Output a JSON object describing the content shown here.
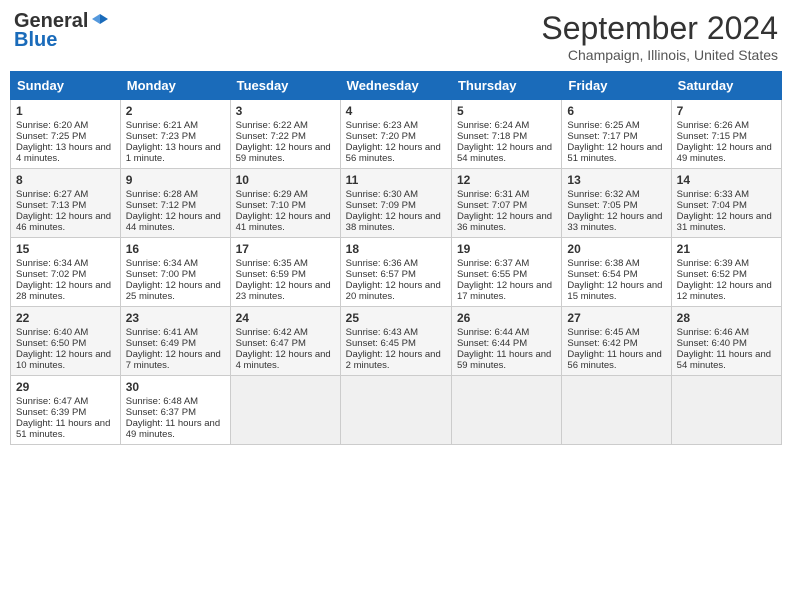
{
  "header": {
    "logo_line1": "General",
    "logo_line2": "Blue",
    "month_title": "September 2024",
    "location": "Champaign, Illinois, United States"
  },
  "days_of_week": [
    "Sunday",
    "Monday",
    "Tuesday",
    "Wednesday",
    "Thursday",
    "Friday",
    "Saturday"
  ],
  "weeks": [
    [
      {
        "day": "1",
        "sunrise": "Sunrise: 6:20 AM",
        "sunset": "Sunset: 7:25 PM",
        "daylight": "Daylight: 13 hours and 4 minutes."
      },
      {
        "day": "2",
        "sunrise": "Sunrise: 6:21 AM",
        "sunset": "Sunset: 7:23 PM",
        "daylight": "Daylight: 13 hours and 1 minute."
      },
      {
        "day": "3",
        "sunrise": "Sunrise: 6:22 AM",
        "sunset": "Sunset: 7:22 PM",
        "daylight": "Daylight: 12 hours and 59 minutes."
      },
      {
        "day": "4",
        "sunrise": "Sunrise: 6:23 AM",
        "sunset": "Sunset: 7:20 PM",
        "daylight": "Daylight: 12 hours and 56 minutes."
      },
      {
        "day": "5",
        "sunrise": "Sunrise: 6:24 AM",
        "sunset": "Sunset: 7:18 PM",
        "daylight": "Daylight: 12 hours and 54 minutes."
      },
      {
        "day": "6",
        "sunrise": "Sunrise: 6:25 AM",
        "sunset": "Sunset: 7:17 PM",
        "daylight": "Daylight: 12 hours and 51 minutes."
      },
      {
        "day": "7",
        "sunrise": "Sunrise: 6:26 AM",
        "sunset": "Sunset: 7:15 PM",
        "daylight": "Daylight: 12 hours and 49 minutes."
      }
    ],
    [
      {
        "day": "8",
        "sunrise": "Sunrise: 6:27 AM",
        "sunset": "Sunset: 7:13 PM",
        "daylight": "Daylight: 12 hours and 46 minutes."
      },
      {
        "day": "9",
        "sunrise": "Sunrise: 6:28 AM",
        "sunset": "Sunset: 7:12 PM",
        "daylight": "Daylight: 12 hours and 44 minutes."
      },
      {
        "day": "10",
        "sunrise": "Sunrise: 6:29 AM",
        "sunset": "Sunset: 7:10 PM",
        "daylight": "Daylight: 12 hours and 41 minutes."
      },
      {
        "day": "11",
        "sunrise": "Sunrise: 6:30 AM",
        "sunset": "Sunset: 7:09 PM",
        "daylight": "Daylight: 12 hours and 38 minutes."
      },
      {
        "day": "12",
        "sunrise": "Sunrise: 6:31 AM",
        "sunset": "Sunset: 7:07 PM",
        "daylight": "Daylight: 12 hours and 36 minutes."
      },
      {
        "day": "13",
        "sunrise": "Sunrise: 6:32 AM",
        "sunset": "Sunset: 7:05 PM",
        "daylight": "Daylight: 12 hours and 33 minutes."
      },
      {
        "day": "14",
        "sunrise": "Sunrise: 6:33 AM",
        "sunset": "Sunset: 7:04 PM",
        "daylight": "Daylight: 12 hours and 31 minutes."
      }
    ],
    [
      {
        "day": "15",
        "sunrise": "Sunrise: 6:34 AM",
        "sunset": "Sunset: 7:02 PM",
        "daylight": "Daylight: 12 hours and 28 minutes."
      },
      {
        "day": "16",
        "sunrise": "Sunrise: 6:34 AM",
        "sunset": "Sunset: 7:00 PM",
        "daylight": "Daylight: 12 hours and 25 minutes."
      },
      {
        "day": "17",
        "sunrise": "Sunrise: 6:35 AM",
        "sunset": "Sunset: 6:59 PM",
        "daylight": "Daylight: 12 hours and 23 minutes."
      },
      {
        "day": "18",
        "sunrise": "Sunrise: 6:36 AM",
        "sunset": "Sunset: 6:57 PM",
        "daylight": "Daylight: 12 hours and 20 minutes."
      },
      {
        "day": "19",
        "sunrise": "Sunrise: 6:37 AM",
        "sunset": "Sunset: 6:55 PM",
        "daylight": "Daylight: 12 hours and 17 minutes."
      },
      {
        "day": "20",
        "sunrise": "Sunrise: 6:38 AM",
        "sunset": "Sunset: 6:54 PM",
        "daylight": "Daylight: 12 hours and 15 minutes."
      },
      {
        "day": "21",
        "sunrise": "Sunrise: 6:39 AM",
        "sunset": "Sunset: 6:52 PM",
        "daylight": "Daylight: 12 hours and 12 minutes."
      }
    ],
    [
      {
        "day": "22",
        "sunrise": "Sunrise: 6:40 AM",
        "sunset": "Sunset: 6:50 PM",
        "daylight": "Daylight: 12 hours and 10 minutes."
      },
      {
        "day": "23",
        "sunrise": "Sunrise: 6:41 AM",
        "sunset": "Sunset: 6:49 PM",
        "daylight": "Daylight: 12 hours and 7 minutes."
      },
      {
        "day": "24",
        "sunrise": "Sunrise: 6:42 AM",
        "sunset": "Sunset: 6:47 PM",
        "daylight": "Daylight: 12 hours and 4 minutes."
      },
      {
        "day": "25",
        "sunrise": "Sunrise: 6:43 AM",
        "sunset": "Sunset: 6:45 PM",
        "daylight": "Daylight: 12 hours and 2 minutes."
      },
      {
        "day": "26",
        "sunrise": "Sunrise: 6:44 AM",
        "sunset": "Sunset: 6:44 PM",
        "daylight": "Daylight: 11 hours and 59 minutes."
      },
      {
        "day": "27",
        "sunrise": "Sunrise: 6:45 AM",
        "sunset": "Sunset: 6:42 PM",
        "daylight": "Daylight: 11 hours and 56 minutes."
      },
      {
        "day": "28",
        "sunrise": "Sunrise: 6:46 AM",
        "sunset": "Sunset: 6:40 PM",
        "daylight": "Daylight: 11 hours and 54 minutes."
      }
    ],
    [
      {
        "day": "29",
        "sunrise": "Sunrise: 6:47 AM",
        "sunset": "Sunset: 6:39 PM",
        "daylight": "Daylight: 11 hours and 51 minutes."
      },
      {
        "day": "30",
        "sunrise": "Sunrise: 6:48 AM",
        "sunset": "Sunset: 6:37 PM",
        "daylight": "Daylight: 11 hours and 49 minutes."
      },
      null,
      null,
      null,
      null,
      null
    ]
  ]
}
